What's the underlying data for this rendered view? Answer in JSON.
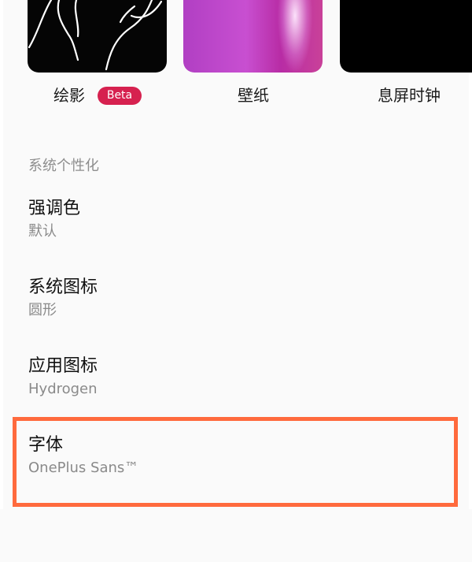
{
  "tiles": [
    {
      "label": "绘影",
      "badge": "Beta",
      "icon": "drawing-preview"
    },
    {
      "label": "壁纸",
      "icon": "wallpaper-preview"
    },
    {
      "label": "息屏时钟",
      "icon": "aod-clock-preview"
    }
  ],
  "section": {
    "header": "系统个性化",
    "items": [
      {
        "title": "强调色",
        "summary": "默认"
      },
      {
        "title": "系统图标",
        "summary": "圆形"
      },
      {
        "title": "应用图标",
        "summary": "Hydrogen"
      },
      {
        "title": "字体",
        "summary": "OnePlus Sans™"
      }
    ]
  },
  "colors": {
    "badge": "#d6214f",
    "highlight": "#ff6a3d",
    "background": "#fafafa"
  },
  "highlighted_item": "字体"
}
